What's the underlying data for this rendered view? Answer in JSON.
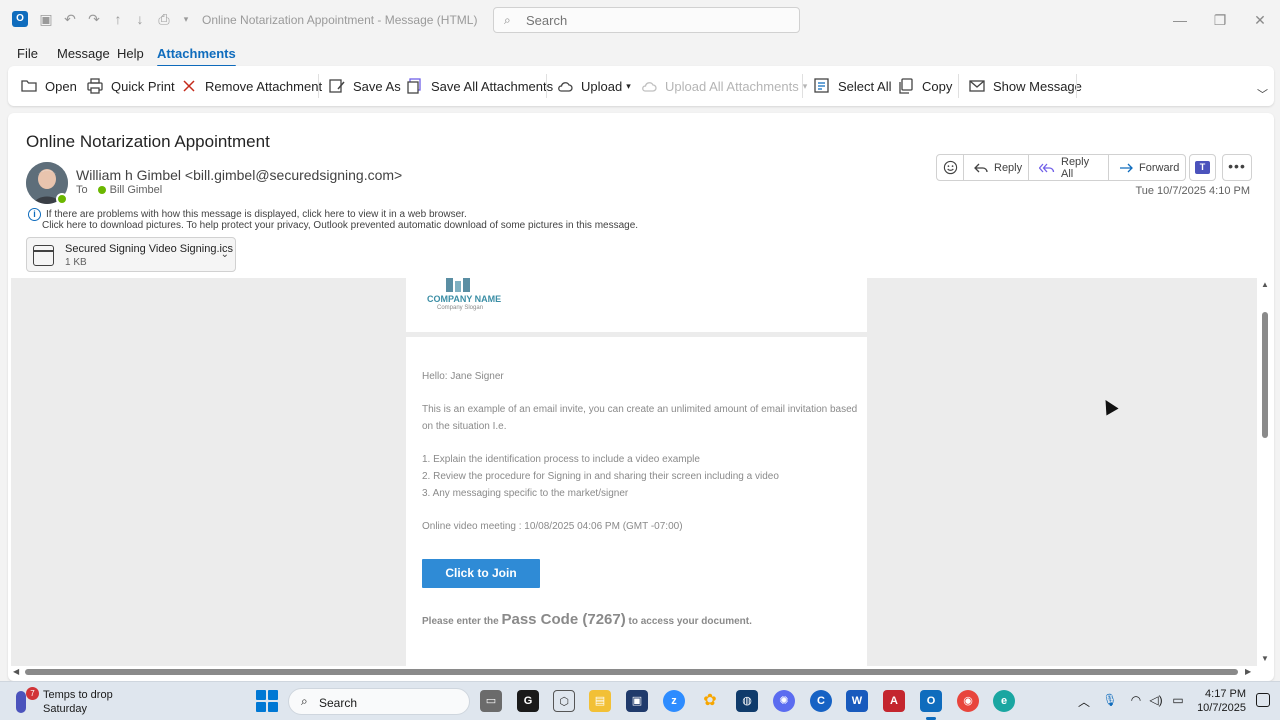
{
  "window": {
    "title": "Online Notarization Appointment  -  Message (HTML)",
    "search_placeholder": "Search"
  },
  "menu": {
    "tabs": [
      {
        "label": "File"
      },
      {
        "label": "Message"
      },
      {
        "label": "Help"
      },
      {
        "label": "Attachments",
        "active": true
      }
    ]
  },
  "ribbon": {
    "open": "Open",
    "quick_print": "Quick Print",
    "remove_attachment": "Remove Attachment",
    "save_as": "Save As",
    "save_all_attachments": "Save All Attachments",
    "upload": "Upload",
    "upload_all_attachments": "Upload All Attachments",
    "select_all": "Select All",
    "copy": "Copy",
    "show_message": "Show Message"
  },
  "message": {
    "subject": "Online Notarization Appointment",
    "sender": "William h Gimbel <bill.gimbel@securedsigning.com>",
    "to_label": "To",
    "recipient": "Bill Gimbel",
    "info_line_1": "If there are problems with how this message is displayed, click here to view it in a web browser.",
    "info_line_2": "Click here to download pictures. To help protect your privacy, Outlook prevented automatic download of some pictures in this message.",
    "datetime": "Tue 10/7/2025 4:10 PM",
    "actions": {
      "reply": "Reply",
      "reply_all": "Reply All",
      "forward": "Forward"
    },
    "attachment": {
      "name": "Secured Signing Video Signing.ics",
      "size": "1 KB"
    }
  },
  "email_body": {
    "company_name": "COMPANY NAME",
    "company_slogan": "Company Slogan",
    "greeting": "Hello:  Jane Signer",
    "intro": "This is an example of an email invite, you can create an unlimited amount of email invitation based on the situation I.e.",
    "list": [
      "1. Explain the identification process to include a video example",
      "2. Review the procedure for Signing in and sharing their screen including a video",
      "3. Any messaging specific to the market/signer"
    ],
    "meeting": "Online video meeting : 10/08/2025 04:06 PM (GMT -07:00)",
    "join_button": "Click to Join",
    "passcode_prefix": "Please enter the ",
    "passcode_value": "Pass Code (7267)",
    "passcode_suffix": " to access your document."
  },
  "taskbar": {
    "weather_badge": "7",
    "weather_title": "Temps to drop",
    "weather_day": "Saturday",
    "search_label": "Search",
    "time": "4:17 PM",
    "date": "10/7/2025"
  }
}
